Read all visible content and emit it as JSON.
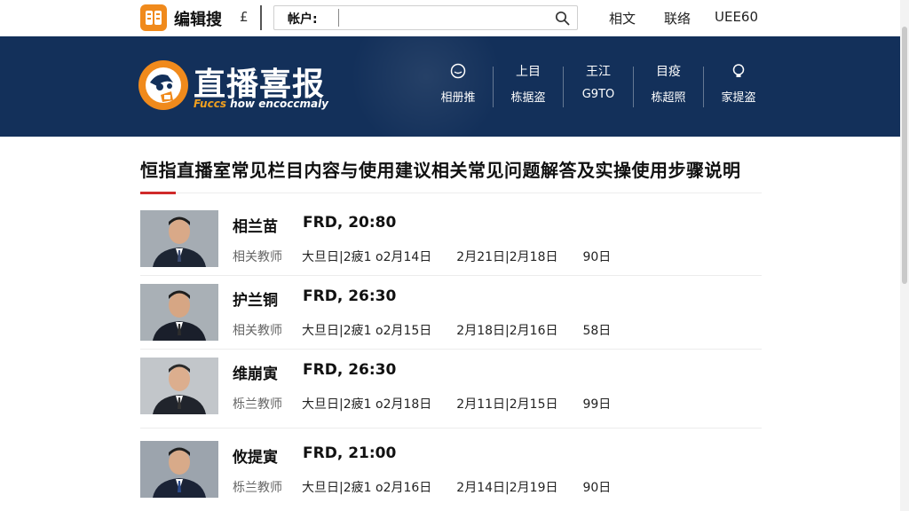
{
  "topbar": {
    "brand": "编辑搜",
    "mark": "£",
    "search_label": "帐户:",
    "search_placeholder": "",
    "links": [
      "相文",
      "联络",
      "UEE60"
    ]
  },
  "banner": {
    "title": "直播喜报",
    "subtitle_highlight": "Fuccs",
    "subtitle_rest": " how encoccmaly",
    "nav": [
      {
        "icon": "smile-icon",
        "top": "",
        "bottom": "相册推"
      },
      {
        "icon": "",
        "top": "上目",
        "bottom": "栋据盗"
      },
      {
        "icon": "",
        "top": "王江",
        "bottom": "G9TO"
      },
      {
        "icon": "",
        "top": "目疫",
        "bottom": "栋超照"
      },
      {
        "icon": "bulb-icon",
        "top": "",
        "bottom": "家提盗"
      }
    ]
  },
  "main": {
    "title": "恒指直播室常见栏目内容与使用建议相关常见问题解答及实操使用步骤说明"
  },
  "list": [
    {
      "name": "相兰苗",
      "time": "FRD, 20:80",
      "role": "相关教师",
      "d1": "大旦日",
      "d2": "2疲1",
      "d3": "o2月14日",
      "d4": "2月21日",
      "d5": "2月18日",
      "d6": "90日"
    },
    {
      "name": "护兰铜",
      "time": "FRD, 26:30",
      "role": "相关教师",
      "d1": "大旦日",
      "d2": "2疲1",
      "d3": "o2月15日",
      "d4": "2月18日",
      "d5": "2月16日",
      "d6": "58日"
    },
    {
      "name": "维崩寅",
      "time": "FRD, 26:30",
      "role": "栎兰教师",
      "d1": "大旦日",
      "d2": "2疲1",
      "d3": "o2月18日",
      "d4": "2月11日",
      "d5": "2月15日",
      "d6": "99日"
    },
    {
      "name": "攸提寅",
      "time": "FRD, 21:00",
      "role": "栎兰教师",
      "d1": "大旦日",
      "d2": "2疲1",
      "d3": "o2月16日",
      "d4": "2月14日",
      "d5": "2月19日",
      "d6": "90日"
    }
  ],
  "colors": {
    "banner_bg": "#13305a",
    "accent_orange": "#f08a1c",
    "accent_red": "#d02a2a"
  }
}
